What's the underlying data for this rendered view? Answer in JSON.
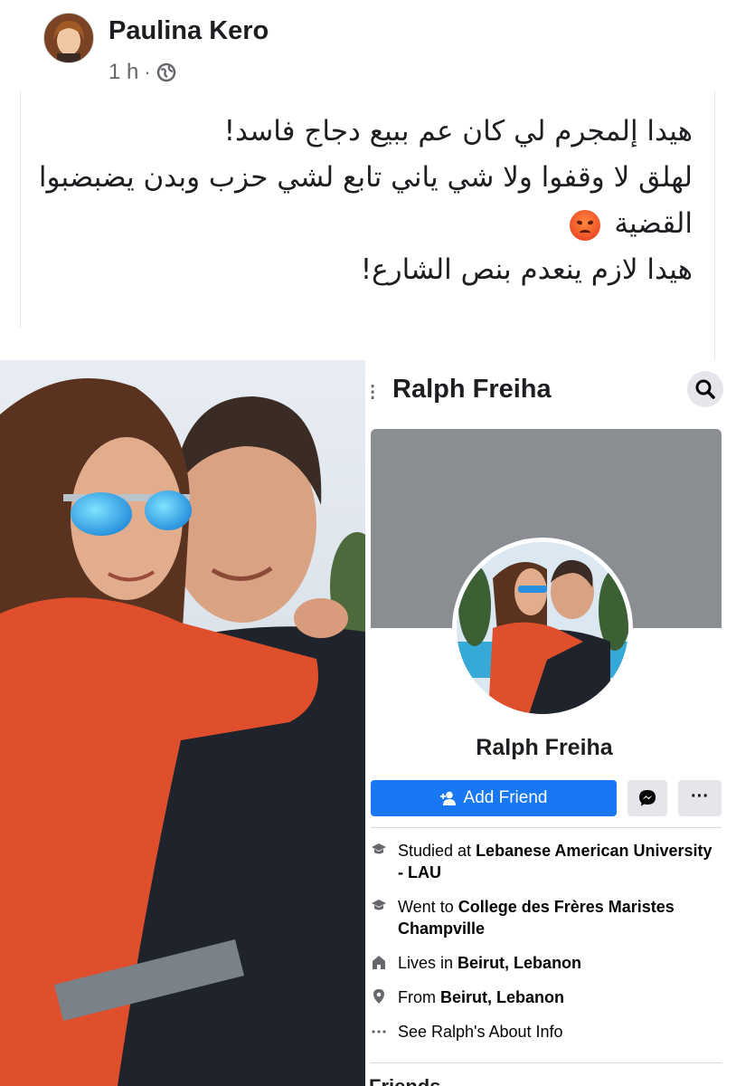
{
  "post": {
    "author_name": "Paulina Kero",
    "timestamp": "1 h",
    "separator": "·",
    "privacy_icon": "globe-icon",
    "text_lines": [
      "هيدا إلمجرم لي كان عم ببيع دجاج فاسد!",
      "لهلق لا وقفوا ولا شي ياني تابع لشي حزب وبدن يضبضبوا",
      "القضية",
      "هيدا لازم ينعدم بنص الشارع!"
    ],
    "emoji": "angry-face"
  },
  "profile": {
    "top_name": "Ralph Freiha",
    "name": "Ralph Freiha",
    "add_friend_label": "Add Friend",
    "more_label": "···",
    "info": [
      {
        "icon": "graduation-cap-icon",
        "prefix": "Studied at ",
        "value": "Lebanese American University - LAU"
      },
      {
        "icon": "graduation-cap-icon",
        "prefix": "Went to ",
        "value": "College des Frères Maristes Champville"
      },
      {
        "icon": "home-icon",
        "prefix": "Lives in ",
        "value": "Beirut, Lebanon"
      },
      {
        "icon": "location-pin-icon",
        "prefix": "From ",
        "value": "Beirut, Lebanon"
      },
      {
        "icon": "more-dots-icon",
        "prefix": "",
        "value": "See Ralph's About Info"
      }
    ],
    "friends_heading": "Friends"
  },
  "colors": {
    "accent": "#1877f2",
    "cover": "#8a8d91",
    "button_gray": "#e4e6eb"
  }
}
